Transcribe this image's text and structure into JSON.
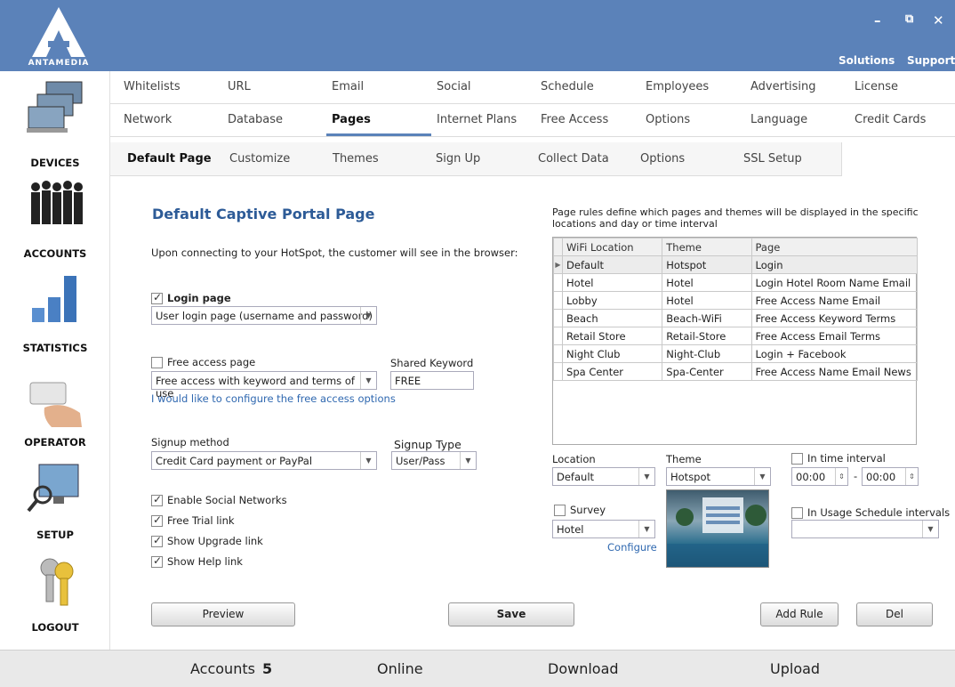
{
  "app": {
    "logo_text": "ANTAMEDIA",
    "window_controls": [
      "–",
      "⧉",
      "✕"
    ],
    "top_links": [
      "Solutions",
      "Support"
    ]
  },
  "sidebar": {
    "items": [
      {
        "label": "DEVICES",
        "icon": "computers-icon"
      },
      {
        "label": "ACCOUNTS",
        "icon": "people-icon"
      },
      {
        "label": "STATISTICS",
        "icon": "bar-chart-icon"
      },
      {
        "label": "OPERATOR",
        "icon": "hand-card-icon"
      },
      {
        "label": "SETUP",
        "icon": "monitor-magnifier-icon"
      },
      {
        "label": "LOGOUT",
        "icon": "keys-icon"
      }
    ]
  },
  "nav": {
    "row1": [
      "Whitelists",
      "URL",
      "Email",
      "Social",
      "Schedule",
      "Employees",
      "Advertising",
      "License"
    ],
    "row2": [
      "Network",
      "Database",
      "Pages",
      "Internet Plans",
      "Free Access",
      "Options",
      "Language",
      "Credit Cards"
    ],
    "active": "Pages"
  },
  "subnav": {
    "items": [
      "Default Page",
      "Customize",
      "Themes",
      "Sign Up",
      "Collect Data",
      "Options",
      "SSL Setup"
    ],
    "active": "Default Page"
  },
  "main": {
    "title": "Default Captive Portal Page",
    "intro": "Upon connecting to your HotSpot, the customer will see in the browser:",
    "login_page_label": "Login page",
    "login_page_checked": true,
    "login_page_select": "User login page (username and password)",
    "free_access_label": "Free access page",
    "free_access_checked": false,
    "free_access_select": "Free access with keyword and terms of use",
    "shared_keyword_label": "Shared Keyword",
    "shared_keyword_value": "FREE",
    "free_access_link": "I would like to configure the free access options",
    "signup_method_label": "Signup method",
    "signup_method_value": "Credit Card payment or PayPal",
    "signup_type_label": "Signup Type",
    "signup_type_value": "User/Pass",
    "options": [
      {
        "label": "Enable Social Networks",
        "checked": true
      },
      {
        "label": "Free Trial link",
        "checked": true
      },
      {
        "label": "Show Upgrade link",
        "checked": true
      },
      {
        "label": "Show Help link",
        "checked": true
      }
    ],
    "preview_button": "Preview",
    "save_button": "Save"
  },
  "rules": {
    "description": "Page rules define which pages and themes will be displayed in the specific locations and day or time interval",
    "columns": [
      "WiFi Location",
      "Theme",
      "Page"
    ],
    "rows": [
      [
        "Default",
        "Hotspot",
        "Login"
      ],
      [
        "Hotel",
        "Hotel",
        "Login Hotel Room Name Email"
      ],
      [
        "Lobby",
        "Hotel",
        "Free Access Name Email"
      ],
      [
        "Beach",
        "Beach-WiFi",
        "Free Access Keyword Terms"
      ],
      [
        "Retail Store",
        "Retail-Store",
        "Free Access Email Terms"
      ],
      [
        "Night Club",
        "Night-Club",
        "Login + Facebook"
      ],
      [
        "Spa Center",
        "Spa-Center",
        "Free Access Name Email News"
      ]
    ],
    "location_label": "Location",
    "location_value": "Default",
    "theme_label": "Theme",
    "theme_value": "Hotspot",
    "time_interval_label": "In time interval",
    "time_from": "00:00",
    "time_to": "00:00",
    "time_sep": "-",
    "survey_label": "Survey",
    "survey_value": "Hotel",
    "configure_link": "Configure",
    "usage_schedule_label": "In Usage Schedule intervals",
    "add_rule_button": "Add Rule",
    "del_button": "Del"
  },
  "footer": {
    "accounts_label": "Accounts",
    "accounts_count": "5",
    "online_label": "Online",
    "download_label": "Download",
    "upload_label": "Upload"
  }
}
